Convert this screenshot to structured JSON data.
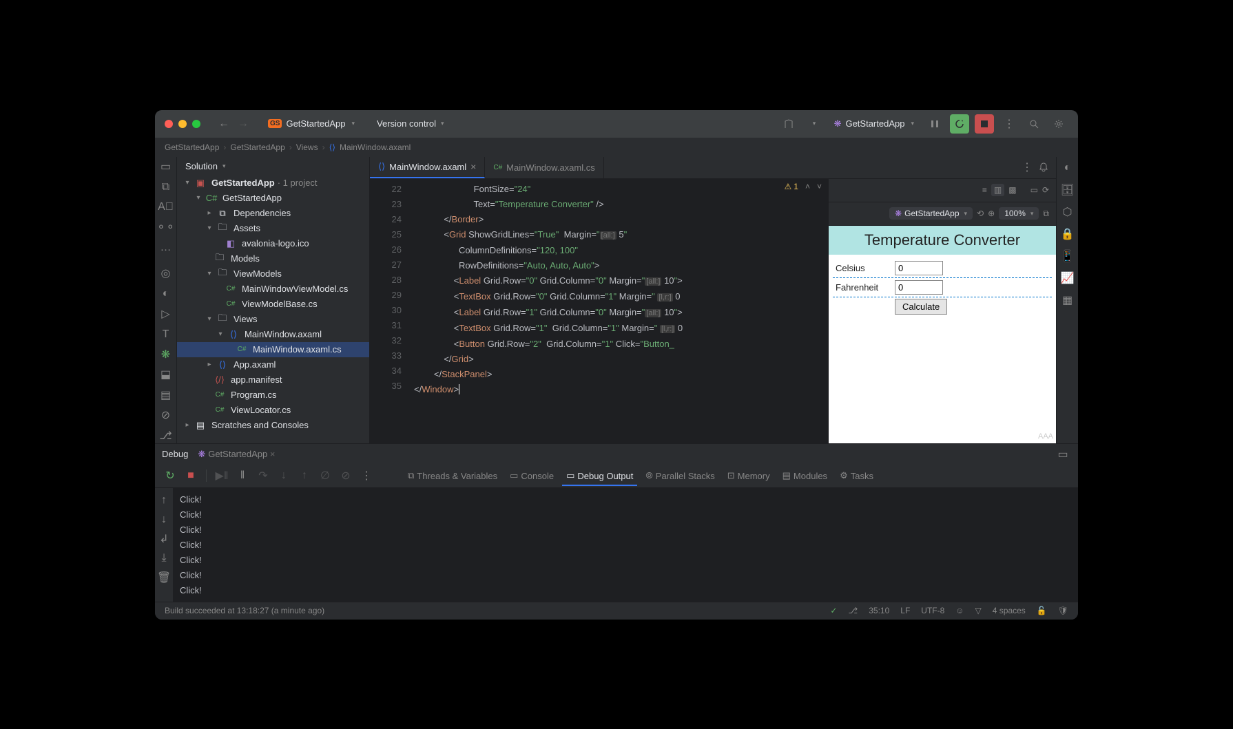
{
  "titlebar": {
    "project_badge": "GS",
    "project_name": "GetStartedApp",
    "vcs": "Version control",
    "run_config": "GetStartedApp"
  },
  "breadcrumbs": [
    "GetStartedApp",
    "GetStartedApp",
    "Views",
    "MainWindow.axaml"
  ],
  "solution": {
    "header": "Solution",
    "tree": {
      "root": "GetStartedApp",
      "root_suffix": "· 1 project",
      "project": "GetStartedApp",
      "dependencies": "Dependencies",
      "assets": "Assets",
      "logo": "avalonia-logo.ico",
      "models": "Models",
      "viewmodels": "ViewModels",
      "vm1": "MainWindowViewModel.cs",
      "vm2": "ViewModelBase.cs",
      "views": "Views",
      "mainwin": "MainWindow.axaml",
      "mainwincs": "MainWindow.axaml.cs",
      "app": "App.axaml",
      "manifest": "app.manifest",
      "program": "Program.cs",
      "locator": "ViewLocator.cs",
      "scratches": "Scratches and Consoles"
    }
  },
  "tabs": {
    "tab1": "MainWindow.axaml",
    "tab2": "MainWindow.axaml.cs"
  },
  "editor_status": {
    "warnings": "1"
  },
  "code_lines": [
    {
      "n": 22,
      "html": "                        FontSize=<span class='str'>\"24\"</span>"
    },
    {
      "n": 23,
      "html": "                        Text=<span class='str'>\"Temperature Converter\"</span> /&gt;"
    },
    {
      "n": 24,
      "html": "            &lt;/<span class='tag'>Border</span>&gt;"
    },
    {
      "n": 25,
      "html": "            &lt;<span class='tag'>Grid</span> ShowGridLines=<span class='str'>\"True\"</span>  Margin=<span class='str'>\"</span><span class='inj'>[all:]</span> 5<span class='str'>\"</span>"
    },
    {
      "n": 26,
      "html": "                  ColumnDefinitions=<span class='str'>\"120, 100\"</span>"
    },
    {
      "n": 27,
      "html": "                  RowDefinitions=<span class='str'>\"Auto, Auto, Auto\"</span>&gt;"
    },
    {
      "n": 28,
      "html": "                &lt;<span class='tag'>Label</span> Grid.Row=<span class='str'>\"0\"</span> Grid.Column=<span class='str'>\"0\"</span> Margin=<span class='str'>\"</span><span class='inj'>[all:]</span> 10<span class='str'>\"</span>&gt;"
    },
    {
      "n": 29,
      "html": "                &lt;<span class='tag'>TextBox</span> Grid.Row=<span class='str'>\"0\"</span> Grid.Column=<span class='str'>\"1\"</span> Margin=<span class='str'>\"</span> <span class='inj'>[l,r:]</span> 0"
    },
    {
      "n": 30,
      "html": "                &lt;<span class='tag'>Label</span> Grid.Row=<span class='str'>\"1\"</span> Grid.Column=<span class='str'>\"0\"</span> Margin=<span class='str'>\"</span><span class='inj'>[all:]</span> 10<span class='str'>\"</span>&gt;"
    },
    {
      "n": 31,
      "html": "                &lt;<span class='tag'>TextBox</span> Grid.Row=<span class='str'>\"1\"</span>  Grid.Column=<span class='str'>\"1\"</span> Margin=<span class='str'>\"</span> <span class='inj'>[l,r:]</span> 0"
    },
    {
      "n": 32,
      "html": "                &lt;<span class='tag'>Button</span> Grid.Row=<span class='str'>\"2\"</span>  Grid.Column=<span class='str'>\"1\"</span> Click=<span class='str'>\"Button_</span>"
    },
    {
      "n": 33,
      "html": "            &lt;/<span class='tag'>Grid</span>&gt;"
    },
    {
      "n": 34,
      "html": "        &lt;/<span class='tag'>StackPanel</span>&gt;"
    },
    {
      "n": 35,
      "html": "&lt;/<span class='tag'>Window</span>&gt;<span style='border-left:1px solid #fff;'>&nbsp;</span>"
    }
  ],
  "preview": {
    "target": "GetStartedApp",
    "zoom": "100%",
    "title": "Temperature Converter",
    "celsius_label": "Celsius",
    "celsius_value": "0",
    "fahrenheit_label": "Fahrenheit",
    "fahrenheit_value": "0",
    "button": "Calculate"
  },
  "debug": {
    "tab_debug": "Debug",
    "tab_app": "GetStartedApp",
    "sub_threads": "Threads & Variables",
    "sub_console": "Console",
    "sub_debugout": "Debug Output",
    "sub_stacks": "Parallel Stacks",
    "sub_memory": "Memory",
    "sub_modules": "Modules",
    "sub_tasks": "Tasks",
    "output_lines": [
      "Click!",
      "Click!",
      "Click!",
      "Click!",
      "Click!",
      "Click!",
      "Click!"
    ]
  },
  "status": {
    "build": "Build succeeded at 13:18:27 (a minute ago)",
    "pos": "35:10",
    "eol": "LF",
    "enc": "UTF-8",
    "indent": "4 spaces"
  }
}
